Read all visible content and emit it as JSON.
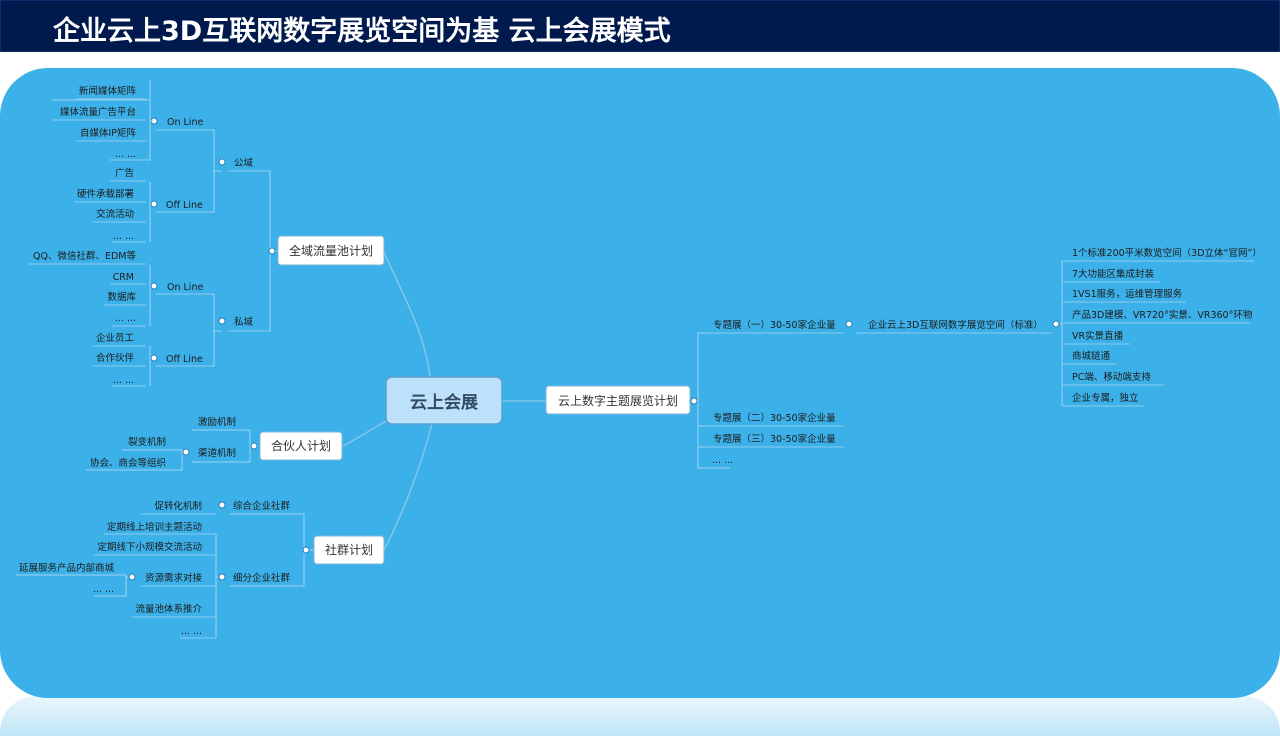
{
  "title": "企业云上3D互联网数字展览空间为基 云上会展模式",
  "mindmap": {
    "center": "云上会展",
    "b1": {
      "label": "全域流量池计划",
      "gongyu": "公域",
      "siyu": "私域",
      "online": "On Line",
      "offline": "Off Line",
      "gongyu_on": [
        "新闻媒体矩阵",
        "媒体流量广告平台",
        "自媒体IP矩阵",
        "... ..."
      ],
      "gongyu_off": [
        "广告",
        "硬件承载部署",
        "交流活动",
        "... ..."
      ],
      "siyu_on": [
        "QQ、微信社群、EDM等",
        "CRM",
        "数据库",
        "... ..."
      ],
      "siyu_off": [
        "企业员工",
        "合作伙伴",
        "... ..."
      ]
    },
    "b2": {
      "label": "合伙人计划",
      "jili": "激励机制",
      "qudao": "渠道机制",
      "qudao_items": [
        "裂变机制",
        "协会、商会等组织"
      ]
    },
    "b3": {
      "label": "社群计划",
      "zonghe": "综合企业社群",
      "zonghe_item": "促转化机制",
      "xifen": "细分企业社群",
      "xifen_items": [
        "定期线上培训主题活动",
        "定期线下小规模交流活动",
        "资源需求对接",
        "流量池体系推介",
        "... ..."
      ],
      "ziyuan_items": [
        "延展服务产品内部商城",
        "... ..."
      ]
    },
    "b4": {
      "label": "云上数字主题展览计划",
      "zhuanti": [
        "专题展（一）30-50家企业量",
        "专题展（二）30-50家企业量",
        "专题展（三）30-50家企业量",
        "... ..."
      ],
      "space": "企业云上3D互联网数字展览空间（标准）",
      "space_items": [
        "1个标准200平米数览空间（3D立体“官网”）",
        "7大功能区集成封装",
        "1VS1服务，运维管理服务",
        "产品3D建模、VR720°实景、VR360°环物",
        "VR实景直播",
        "商城链通",
        "PC端、移动端支持",
        "企业专属，独立"
      ]
    }
  }
}
